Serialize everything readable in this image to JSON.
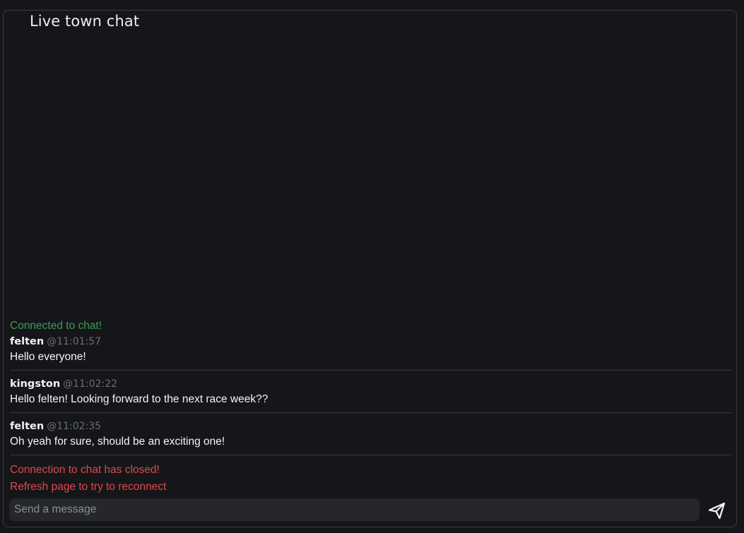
{
  "chat": {
    "title": "Live town chat",
    "status_connected": "Connected to chat!",
    "messages": [
      {
        "author": "felten",
        "time": "@11:01:57",
        "text": "Hello everyone!"
      },
      {
        "author": "kingston",
        "time": "@11:02:22",
        "text": "Hello felten! Looking forward to the next race week??"
      },
      {
        "author": "felten",
        "time": "@11:02:35",
        "text": "Oh yeah for sure, should be an exciting one!"
      }
    ],
    "status_closed": "Connection to chat has closed!",
    "status_refresh": "Refresh page to try to reconnect",
    "input_placeholder": "Send a message",
    "input_value": "",
    "send_icon": "paper-plane-icon"
  },
  "colors": {
    "background": "#151619",
    "connected": "#3e9a57",
    "error": "#dc4a4a",
    "timestamp": "#6b6e74"
  }
}
